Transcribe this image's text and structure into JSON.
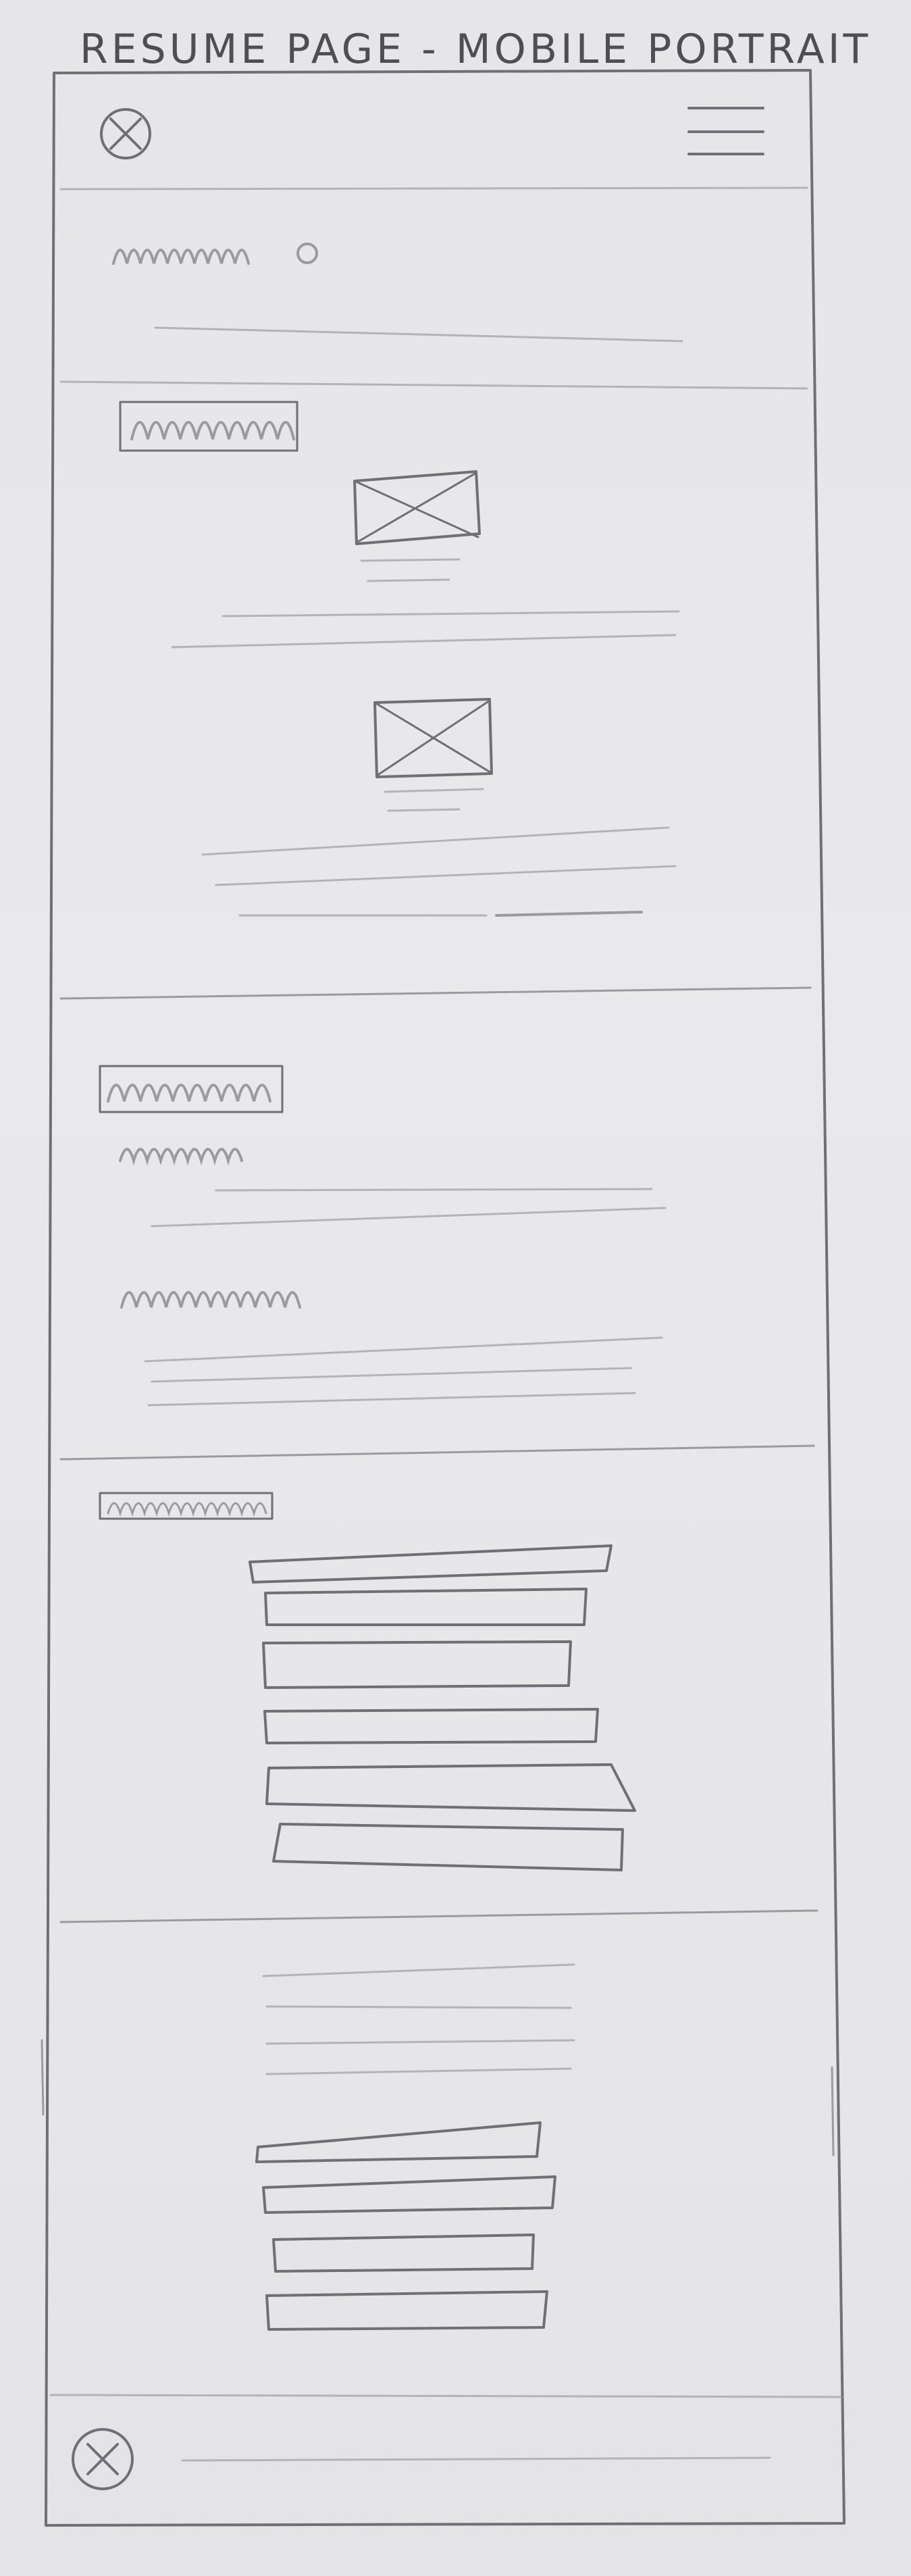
{
  "title": "RESUME PAGE - MOBILE PORTRAIT",
  "header": {
    "logo_icon": "close-circle-icon",
    "menu_icon": "hamburger-menu-icon"
  },
  "footer": {
    "logo_icon": "close-circle-icon"
  },
  "colors": {
    "paper": "#e6e6e9",
    "pencil": "#6f6f75"
  }
}
